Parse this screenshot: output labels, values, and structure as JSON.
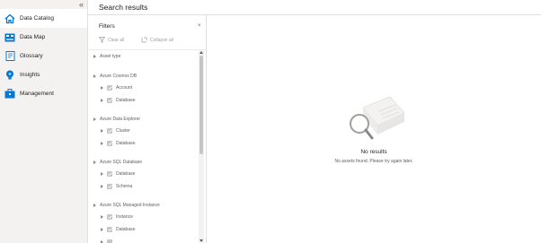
{
  "nav": {
    "collapse_glyph": "«",
    "items": [
      {
        "label": "Data Catalog",
        "icon": "home-icon",
        "active": true
      },
      {
        "label": "Data Map",
        "icon": "data-map-icon",
        "active": false
      },
      {
        "label": "Glossary",
        "icon": "glossary-icon",
        "active": false
      },
      {
        "label": "Insights",
        "icon": "lightbulb-icon",
        "active": false
      },
      {
        "label": "Management",
        "icon": "toolbox-icon",
        "active": false
      }
    ]
  },
  "header": {
    "title": "Search results"
  },
  "filters": {
    "title": "Filters",
    "close_glyph": "×",
    "clear_all": "Clear all",
    "collapse_all": "Collapse all",
    "groups": [
      {
        "label": "Asset type",
        "items": []
      },
      {
        "label": "Azure Cosmos DB",
        "items": [
          "Account",
          "Database"
        ]
      },
      {
        "label": "Azure Data Explorer",
        "items": [
          "Cluster",
          "Database"
        ]
      },
      {
        "label": "Azure SQL Database",
        "items": [
          "Database",
          "Schema"
        ]
      },
      {
        "label": "Azure SQL Managed Instance",
        "items": [
          "Instance",
          "Database"
        ]
      }
    ]
  },
  "results": {
    "empty_title": "No results",
    "empty_message": "No assets found. Please try again later."
  },
  "colors": {
    "accent": "#0078d4",
    "nav_bg": "#f3f2f1",
    "checkbox": "#c8c6c4"
  }
}
